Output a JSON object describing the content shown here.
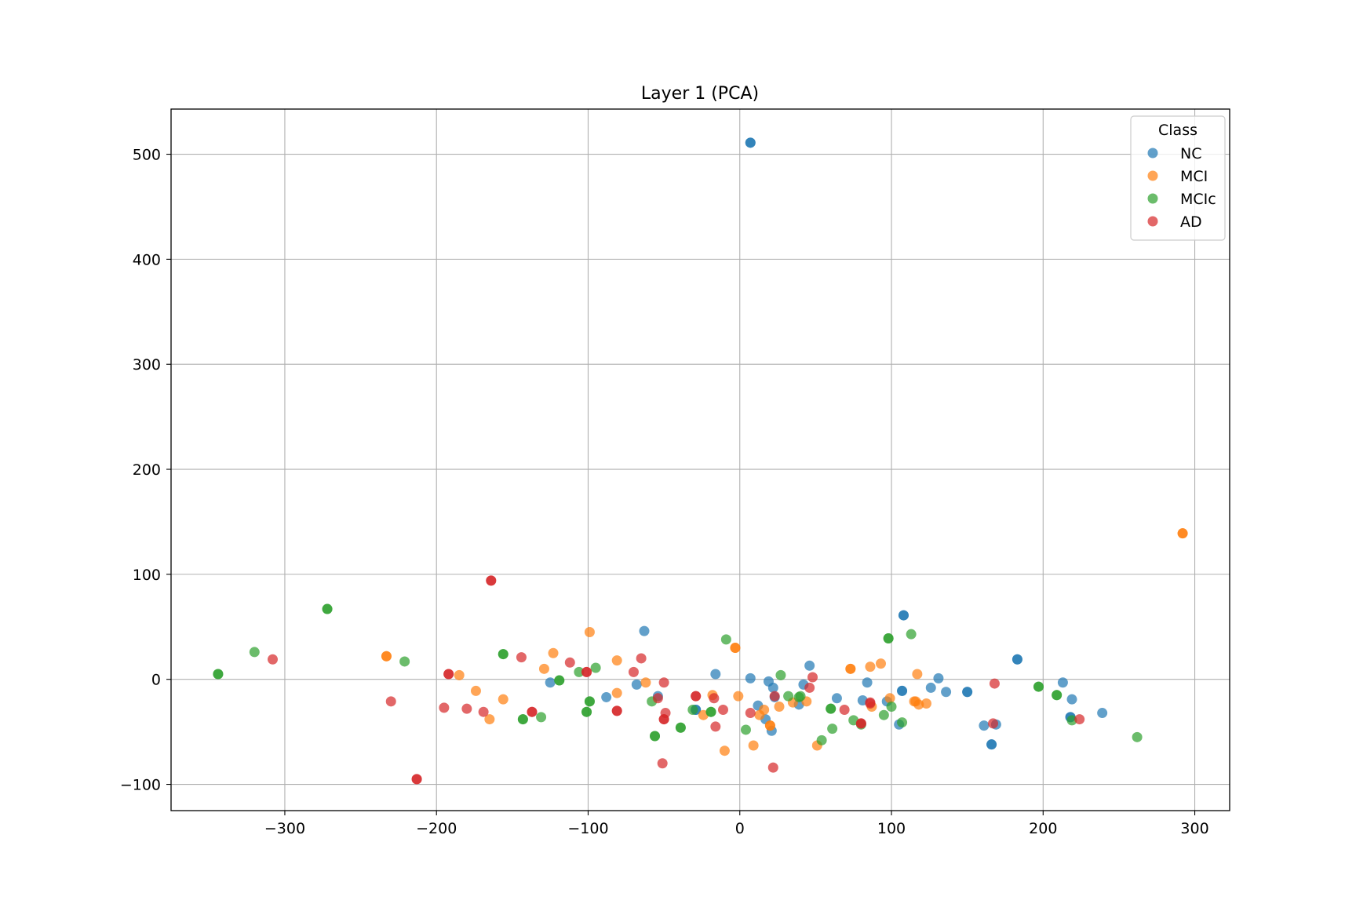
{
  "chart_data": {
    "type": "scatter",
    "title": "Layer 1 (PCA)",
    "xlabel": "",
    "ylabel": "",
    "xlim": [
      -375,
      323
    ],
    "ylim": [
      -125,
      543
    ],
    "xticks": [
      -300,
      -200,
      -100,
      0,
      100,
      200,
      300
    ],
    "yticks": [
      -100,
      0,
      100,
      200,
      300,
      400,
      500
    ],
    "xtick_labels": [
      "−300",
      "−200",
      "−100",
      "0",
      "100",
      "200",
      "300"
    ],
    "ytick_labels": [
      "−100",
      "0",
      "100",
      "200",
      "300",
      "400",
      "500"
    ],
    "grid": true,
    "legend": {
      "title": "Class",
      "placement": "top-right"
    },
    "series": [
      {
        "name": "NC",
        "color": "#1f77b4",
        "points": [
          [
            7,
            511
          ],
          [
            7,
            511
          ],
          [
            -63,
            46
          ],
          [
            -16,
            5
          ],
          [
            7,
            1
          ],
          [
            19,
            -2
          ],
          [
            22,
            -8
          ],
          [
            -68,
            -5
          ],
          [
            -54,
            -16
          ],
          [
            -88,
            -17
          ],
          [
            -125,
            -3
          ],
          [
            12,
            -25
          ],
          [
            17,
            -38
          ],
          [
            21,
            -49
          ],
          [
            23,
            -17
          ],
          [
            42,
            -5
          ],
          [
            46,
            13
          ],
          [
            39,
            -24
          ],
          [
            64,
            -18
          ],
          [
            81,
            -20
          ],
          [
            84,
            -3
          ],
          [
            97,
            -21
          ],
          [
            107,
            -11
          ],
          [
            107,
            -11
          ],
          [
            108,
            61
          ],
          [
            108,
            61
          ],
          [
            105,
            -43
          ],
          [
            126,
            -8
          ],
          [
            131,
            1
          ],
          [
            136,
            -12
          ],
          [
            150,
            -12
          ],
          [
            150,
            -12
          ],
          [
            161,
            -44
          ],
          [
            166,
            -62
          ],
          [
            166,
            -62
          ],
          [
            169,
            -43
          ],
          [
            183,
            19
          ],
          [
            183,
            19
          ],
          [
            213,
            -3
          ],
          [
            218,
            -36
          ],
          [
            218,
            -36
          ],
          [
            219,
            -19
          ],
          [
            239,
            -32
          ],
          [
            -29,
            -29
          ],
          [
            -29,
            -29
          ]
        ]
      },
      {
        "name": "MCI",
        "color": "#ff7f0e",
        "points": [
          [
            292,
            139
          ],
          [
            292,
            139
          ],
          [
            -233,
            22
          ],
          [
            -233,
            22
          ],
          [
            -185,
            4
          ],
          [
            -174,
            -11
          ],
          [
            -165,
            -38
          ],
          [
            -156,
            -19
          ],
          [
            -129,
            10
          ],
          [
            -123,
            25
          ],
          [
            -99,
            45
          ],
          [
            -81,
            18
          ],
          [
            -81,
            -13
          ],
          [
            -62,
            -3
          ],
          [
            -3,
            30
          ],
          [
            -3,
            30
          ],
          [
            -1,
            -16
          ],
          [
            -18,
            -15
          ],
          [
            -24,
            -34
          ],
          [
            -10,
            -68
          ],
          [
            9,
            -63
          ],
          [
            13,
            -34
          ],
          [
            16,
            -29
          ],
          [
            20,
            -44
          ],
          [
            20,
            -44
          ],
          [
            26,
            -26
          ],
          [
            35,
            -22
          ],
          [
            44,
            -21
          ],
          [
            51,
            -63
          ],
          [
            73,
            10
          ],
          [
            73,
            10
          ],
          [
            86,
            12
          ],
          [
            87,
            -26
          ],
          [
            93,
            15
          ],
          [
            99,
            -18
          ],
          [
            115,
            -21
          ],
          [
            116,
            -21
          ],
          [
            117,
            5
          ],
          [
            118,
            -24
          ],
          [
            123,
            -23
          ]
        ]
      },
      {
        "name": "MCIc",
        "color": "#2ca02c",
        "points": [
          [
            -272,
            67
          ],
          [
            -272,
            67
          ],
          [
            -344,
            5
          ],
          [
            -344,
            5
          ],
          [
            -320,
            26
          ],
          [
            -221,
            17
          ],
          [
            -156,
            24
          ],
          [
            -156,
            24
          ],
          [
            -143,
            -38
          ],
          [
            -143,
            -38
          ],
          [
            -131,
            -36
          ],
          [
            -119,
            -1
          ],
          [
            -119,
            -1
          ],
          [
            -106,
            7
          ],
          [
            -101,
            -31
          ],
          [
            -101,
            -31
          ],
          [
            -99,
            -21
          ],
          [
            -99,
            -21
          ],
          [
            -95,
            11
          ],
          [
            -58,
            -21
          ],
          [
            -56,
            -54
          ],
          [
            -56,
            -54
          ],
          [
            -39,
            -46
          ],
          [
            -39,
            -46
          ],
          [
            -31,
            -29
          ],
          [
            -19,
            -31
          ],
          [
            -19,
            -31
          ],
          [
            -9,
            38
          ],
          [
            4,
            -48
          ],
          [
            27,
            4
          ],
          [
            32,
            -16
          ],
          [
            39,
            -17
          ],
          [
            40,
            -16
          ],
          [
            54,
            -58
          ],
          [
            60,
            -28
          ],
          [
            60,
            -28
          ],
          [
            61,
            -47
          ],
          [
            75,
            -39
          ],
          [
            80,
            -43
          ],
          [
            95,
            -34
          ],
          [
            98,
            39
          ],
          [
            98,
            39
          ],
          [
            100,
            -26
          ],
          [
            107,
            -41
          ],
          [
            113,
            43
          ],
          [
            197,
            -7
          ],
          [
            197,
            -7
          ],
          [
            209,
            -15
          ],
          [
            209,
            -15
          ],
          [
            219,
            -39
          ],
          [
            262,
            -55
          ]
        ]
      },
      {
        "name": "AD",
        "color": "#d62728",
        "points": [
          [
            -164,
            94
          ],
          [
            -164,
            94
          ],
          [
            -308,
            19
          ],
          [
            -230,
            -21
          ],
          [
            -213,
            -95
          ],
          [
            -213,
            -95
          ],
          [
            -195,
            -27
          ],
          [
            -192,
            5
          ],
          [
            -192,
            5
          ],
          [
            -180,
            -28
          ],
          [
            -169,
            -31
          ],
          [
            -144,
            21
          ],
          [
            -137,
            -31
          ],
          [
            -137,
            -31
          ],
          [
            -112,
            16
          ],
          [
            -101,
            7
          ],
          [
            -101,
            7
          ],
          [
            -70,
            7
          ],
          [
            -65,
            20
          ],
          [
            -81,
            -30
          ],
          [
            -81,
            -30
          ],
          [
            -54,
            -18
          ],
          [
            -50,
            -38
          ],
          [
            -50,
            -38
          ],
          [
            -50,
            -3
          ],
          [
            -51,
            -80
          ],
          [
            -49,
            -32
          ],
          [
            -29,
            -16
          ],
          [
            -29,
            -16
          ],
          [
            -17,
            -18
          ],
          [
            -16,
            -45
          ],
          [
            -11,
            -29
          ],
          [
            7,
            -32
          ],
          [
            22,
            -84
          ],
          [
            23,
            -16
          ],
          [
            46,
            -8
          ],
          [
            48,
            2
          ],
          [
            69,
            -29
          ],
          [
            80,
            -42
          ],
          [
            80,
            -42
          ],
          [
            86,
            -22
          ],
          [
            86,
            -23
          ],
          [
            167,
            -42
          ],
          [
            168,
            -4
          ],
          [
            224,
            -38
          ]
        ]
      }
    ]
  }
}
